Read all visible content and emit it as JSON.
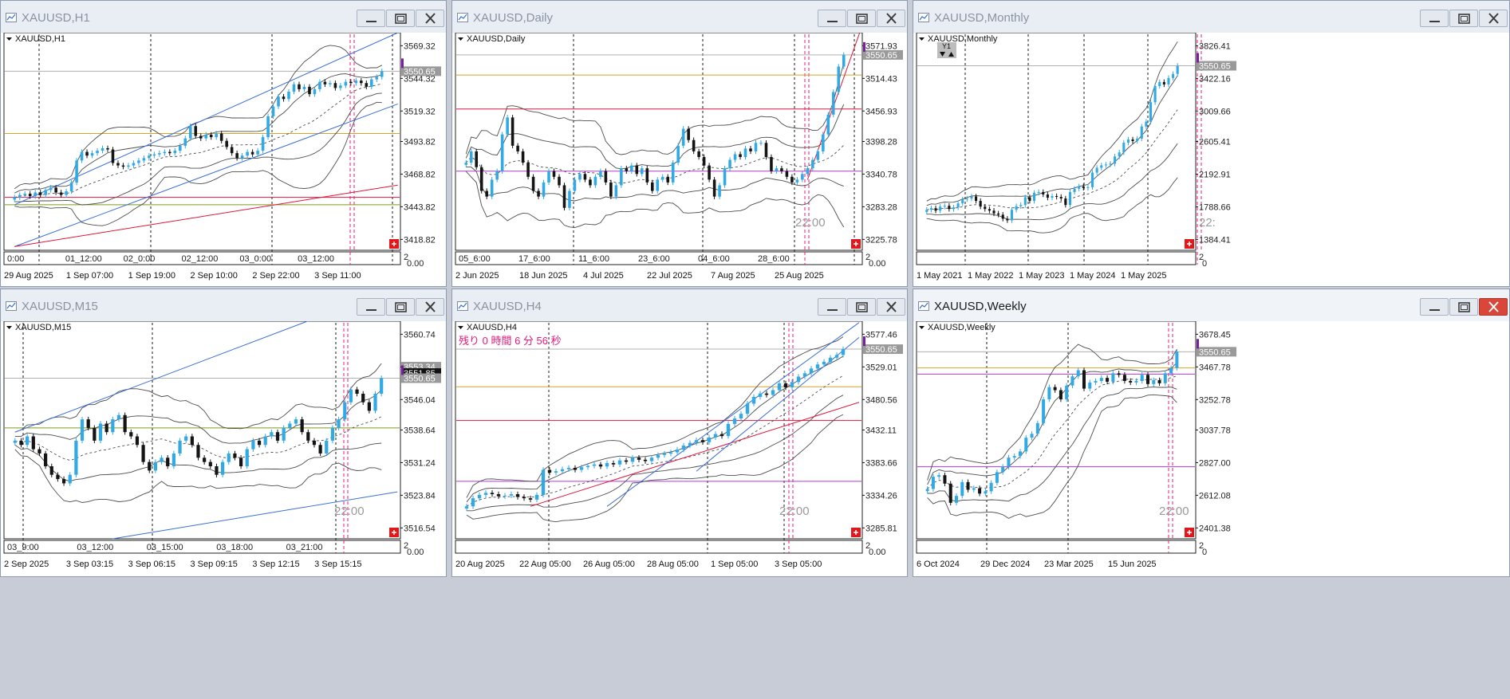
{
  "colors": {
    "bull": "#31a9e4",
    "bear": "#141414",
    "band": "#4d4d4d",
    "grid": "#1a1a1a",
    "price_line": "#b0b0b0",
    "price_tag": "#9a9a9a",
    "now_line": "#e8197a",
    "trend_blue": "#3a6fd8",
    "trend_red": "#e0163b",
    "level_gold": "#d6a52a",
    "level_purple": "#b23ad6",
    "level_olive": "#7e9b1e",
    "close_hot": "#d9463a",
    "accent": "#7a1fa0"
  },
  "windows": [
    {
      "id": "h1",
      "title": "XAUUSD,H1",
      "chart_label": "XAUUSD,H1",
      "active": false,
      "price_tags": [
        "3550.65"
      ],
      "axis_prices": [
        "3569.32",
        "3544.32",
        "3519.32",
        "3493.82",
        "3468.82",
        "3443.82",
        "3418.82"
      ],
      "time_labels": [
        "29 Aug 2025",
        "1 Sep 07:00",
        "1 Sep 19:00",
        "2 Sep 10:00",
        "2 Sep 22:00",
        "3 Sep 11:00"
      ],
      "sep_labels": [
        "0:00",
        "01_12:00",
        "02_0:00",
        "02_12:00",
        "03_0:00",
        "03_12:00"
      ],
      "sub_axis": [
        "2",
        "0.00"
      ],
      "chart_data": {
        "type": "candlestick",
        "symbol": "XAUUSD",
        "timeframe": "H1",
        "ylim": [
          3405,
          3582
        ],
        "last_price": 3550.65,
        "x_start": "29 Aug 2025",
        "x_end": "3 Sep 11:00",
        "closes": [
          3448,
          3450,
          3451,
          3449,
          3452,
          3450,
          3454,
          3456,
          3452,
          3450,
          3453,
          3460,
          3478,
          3485,
          3482,
          3484,
          3486,
          3488,
          3487,
          3476,
          3474,
          3473,
          3474,
          3476,
          3478,
          3480,
          3482,
          3483,
          3484,
          3485,
          3484,
          3486,
          3490,
          3496,
          3506,
          3498,
          3496,
          3499,
          3497,
          3500,
          3494,
          3489,
          3484,
          3480,
          3482,
          3485,
          3483,
          3486,
          3497,
          3514,
          3522,
          3530,
          3528,
          3534,
          3540,
          3536,
          3538,
          3532,
          3536,
          3542,
          3540,
          3541,
          3537,
          3539,
          3542,
          3541,
          3543,
          3541,
          3538,
          3544,
          3546,
          3550.65
        ]
      }
    },
    {
      "id": "daily",
      "title": "XAUUSD,Daily",
      "chart_label": "XAUUSD,Daily",
      "active": false,
      "price_tags": [
        "3550.65"
      ],
      "countdown": "22:00",
      "axis_prices": [
        "3571.93",
        "3514.43",
        "3456.93",
        "3398.28",
        "3340.78",
        "3283.28",
        "3225.78"
      ],
      "time_labels": [
        "2 Jun 2025",
        "18 Jun 2025",
        "4 Jul 2025",
        "22 Jul 2025",
        "7 Aug 2025",
        "25 Aug 2025"
      ],
      "sep_labels": [
        "05_6:00",
        "17_6:00",
        "11_6:00",
        "23_6:00",
        "04_6:00",
        "28_6:00"
      ],
      "sub_axis": [
        "2",
        "0.00"
      ],
      "chart_data": {
        "type": "candlestick",
        "symbol": "XAUUSD",
        "timeframe": "D1",
        "ylim": [
          3205,
          3590
        ],
        "last_price": 3550.65,
        "x_start": "2 Jun 2025",
        "x_end": "25 Aug 2025",
        "closes": [
          3360,
          3380,
          3352,
          3310,
          3300,
          3330,
          3345,
          3410,
          3440,
          3390,
          3380,
          3360,
          3335,
          3310,
          3300,
          3325,
          3345,
          3335,
          3320,
          3280,
          3310,
          3330,
          3340,
          3330,
          3320,
          3335,
          3345,
          3325,
          3300,
          3320,
          3350,
          3345,
          3355,
          3340,
          3350,
          3325,
          3310,
          3330,
          3335,
          3325,
          3360,
          3390,
          3420,
          3400,
          3380,
          3370,
          3355,
          3330,
          3300,
          3320,
          3350,
          3365,
          3375,
          3370,
          3385,
          3380,
          3395,
          3395,
          3370,
          3345,
          3350,
          3345,
          3335,
          3325,
          3330,
          3340,
          3350,
          3365,
          3380,
          3410,
          3445,
          3485,
          3530,
          3550.65
        ]
      }
    },
    {
      "id": "monthly",
      "title": "XAUUSD,Monthly",
      "chart_label": "XAUUSD,Monthly",
      "active": false,
      "price_tags": [
        "3550.65"
      ],
      "countdown": "22:",
      "badge_label": "Y1",
      "axis_prices": [
        "3826.41",
        "3422.16",
        "3009.66",
        "2605.41",
        "2192.91",
        "1788.66",
        "1384.41"
      ],
      "time_labels": [
        "1 May 2021",
        "1 May 2022",
        "1 May 2023",
        "1 May 2024",
        "1 May 2025"
      ],
      "sub_axis": [
        "2",
        "0"
      ],
      "chart_data": {
        "type": "candlestick",
        "symbol": "XAUUSD",
        "timeframe": "MN",
        "ylim": [
          1270,
          3960
        ],
        "last_price": 3550.65,
        "x_start": "1 May 2021",
        "x_end": "1 May 2025",
        "closes": [
          1770,
          1790,
          1760,
          1810,
          1820,
          1780,
          1800,
          1850,
          1900,
          1910,
          1935,
          1880,
          1810,
          1780,
          1760,
          1725,
          1710,
          1660,
          1640,
          1770,
          1815,
          1830,
          1925,
          1880,
          1980,
          1990,
          1960,
          1920,
          1940,
          1930,
          1910,
          1830,
          1990,
          2030,
          2060,
          2040,
          2050,
          2230,
          2290,
          2320,
          2330,
          2340,
          2430,
          2480,
          2600,
          2640,
          2620,
          2650,
          2800,
          2860,
          3100,
          3300,
          3350,
          3320,
          3400,
          3450,
          3550.65
        ]
      }
    },
    {
      "id": "m15",
      "title": "XAUUSD,M15",
      "chart_label": "XAUUSD,M15",
      "active": false,
      "price_tags": [
        "3553.34",
        "3551.85",
        "3550.65"
      ],
      "countdown": "22:00",
      "axis_prices": [
        "3560.74",
        "3553.34",
        "3546.04",
        "3538.64",
        "3531.24",
        "3523.84",
        "3516.54"
      ],
      "time_labels": [
        "2 Sep 2025",
        "3 Sep 03:15",
        "3 Sep 06:15",
        "3 Sep 09:15",
        "3 Sep 12:15",
        "3 Sep 15:15"
      ],
      "sep_labels": [
        "03_9:00",
        "03_12:00",
        "03_15:00",
        "03_18:00",
        "03_21:00"
      ],
      "sub_axis": [
        "2",
        "0.00"
      ],
      "chart_data": {
        "type": "candlestick",
        "symbol": "XAUUSD",
        "timeframe": "M15",
        "ylim": [
          3513,
          3564
        ],
        "last_price": 3550.65,
        "x_start": "2 Sep 2025",
        "x_end": "3 Sep 15:15",
        "closes": [
          3536,
          3535,
          3537,
          3534,
          3533,
          3530,
          3528,
          3527,
          3526,
          3528,
          3536,
          3541,
          3539,
          3536,
          3540,
          3538,
          3541,
          3542,
          3538,
          3537,
          3535,
          3531,
          3529,
          3531,
          3532,
          3530,
          3533,
          3536,
          3537,
          3535,
          3532,
          3531,
          3530,
          3528,
          3531,
          3533,
          3532,
          3530,
          3534,
          3536,
          3535,
          3537,
          3538,
          3536,
          3539,
          3540,
          3541,
          3538,
          3536,
          3535,
          3533,
          3536,
          3539,
          3541,
          3545,
          3548,
          3547,
          3545,
          3543,
          3547,
          3550.65
        ]
      }
    },
    {
      "id": "h4",
      "title": "XAUUSD,H4",
      "chart_label": "XAUUSD,H4",
      "active": false,
      "price_tags": [
        "3550.65"
      ],
      "countdown": "22:00",
      "remaining_text": "残り 0 時間 6 分 56 秒",
      "axis_prices": [
        "3577.46",
        "3529.01",
        "3480.56",
        "3432.11",
        "3383.66",
        "3334.26",
        "3285.81"
      ],
      "time_labels": [
        "20 Aug 2025",
        "22 Aug 05:00",
        "26 Aug 05:00",
        "28 Aug 05:00",
        "1 Sep 05:00",
        "3 Sep 05:00"
      ],
      "sub_axis": [
        "2",
        "0.00"
      ],
      "chart_data": {
        "type": "candlestick",
        "symbol": "XAUUSD",
        "timeframe": "H4",
        "ylim": [
          3270,
          3592
        ],
        "last_price": 3550.65,
        "x_start": "20 Aug 2025",
        "x_end": "3 Sep 05:00",
        "closes": [
          3318,
          3330,
          3335,
          3338,
          3336,
          3333,
          3334,
          3336,
          3332,
          3330,
          3328,
          3335,
          3372,
          3368,
          3370,
          3373,
          3375,
          3372,
          3376,
          3378,
          3380,
          3377,
          3382,
          3380,
          3386,
          3384,
          3390,
          3387,
          3385,
          3390,
          3394,
          3396,
          3398,
          3402,
          3408,
          3412,
          3416,
          3413,
          3420,
          3425,
          3422,
          3440,
          3448,
          3455,
          3470,
          3480,
          3485,
          3483,
          3490,
          3500,
          3494,
          3502,
          3510,
          3515,
          3522,
          3528,
          3532,
          3538,
          3542,
          3550.65
        ]
      }
    },
    {
      "id": "weekly",
      "title": "XAUUSD,Weekly",
      "chart_label": "XAUUSD,Weekly",
      "active": true,
      "price_tags": [
        "3550.65"
      ],
      "countdown": "22:00",
      "axis_prices": [
        "3678.45",
        "3467.78",
        "3252.78",
        "3037.78",
        "2827.00",
        "2612.08",
        "2401.38"
      ],
      "time_labels": [
        "6 Oct 2024",
        "29 Dec 2024",
        "23 Mar 2025",
        "15 Jun 2025"
      ],
      "sub_axis": [
        "2",
        "0"
      ],
      "chart_data": {
        "type": "candlestick",
        "symbol": "XAUUSD",
        "timeframe": "W1",
        "ylim": [
          2330,
          3750
        ],
        "last_price": 3550.65,
        "x_start": "6 Oct 2024",
        "x_end": "15 Jun 2025",
        "closes": [
          2655,
          2735,
          2745,
          2690,
          2565,
          2610,
          2700,
          2650,
          2660,
          2625,
          2640,
          2695,
          2765,
          2800,
          2860,
          2870,
          2900,
          2990,
          3015,
          3085,
          3240,
          3320,
          3300,
          3240,
          3330,
          3390,
          3430,
          3310,
          3350,
          3360,
          3380,
          3355,
          3410,
          3400,
          3360,
          3350,
          3360,
          3400,
          3340,
          3365,
          3345,
          3410,
          3445,
          3550.65
        ]
      }
    }
  ]
}
